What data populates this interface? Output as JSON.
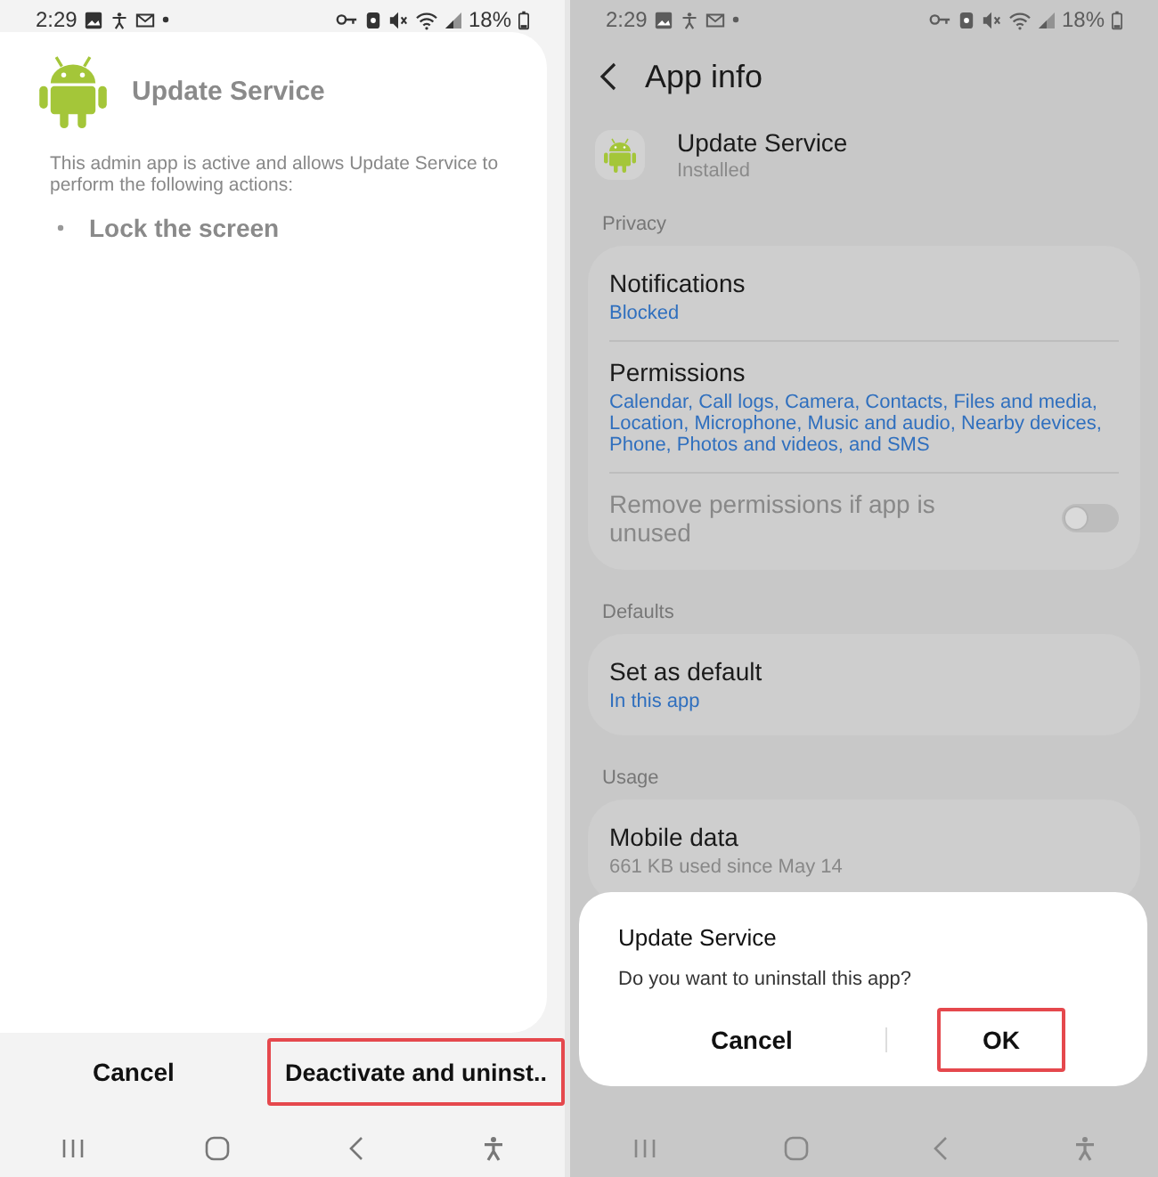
{
  "left_screen": {
    "status_bar": {
      "time": "2:29",
      "battery": "18%"
    },
    "app_name": "Update Service",
    "description": "This admin app is active and allows Update Service to perform the following actions:",
    "actions": [
      "Lock the screen"
    ],
    "buttons": [
      {
        "label": "Cancel",
        "highlighted": false
      },
      {
        "label": "Deactivate and uninst..",
        "highlighted": true
      }
    ]
  },
  "right_screen": {
    "status_bar": {
      "time": "2:29",
      "battery": "18%"
    },
    "title": "App info",
    "app": {
      "name": "Update Service",
      "status": "Installed"
    },
    "sections": [
      {
        "header": "Privacy",
        "items": [
          {
            "kind": "link",
            "title": "Notifications",
            "subtitle": "Blocked"
          },
          {
            "kind": "link",
            "title": "Permissions",
            "subtitle": "Calendar, Call logs, Camera, Contacts, Files and media, Location, Microphone, Music and audio, Nearby devices, Phone, Photos and videos, and SMS"
          },
          {
            "kind": "toggle",
            "title": "Remove permissions if app is unused",
            "on": false,
            "disabled": true
          }
        ]
      },
      {
        "header": "Defaults",
        "items": [
          {
            "kind": "link",
            "title": "Set as default",
            "subtitle": "In this app"
          }
        ]
      },
      {
        "header": "Usage",
        "items": [
          {
            "kind": "info",
            "title": "Mobile data",
            "subtitle": "661 KB used since May 14"
          }
        ]
      }
    ],
    "dialog": {
      "title": "Update Service",
      "message": "Do you want to uninstall this app?",
      "buttons": [
        {
          "label": "Cancel",
          "highlighted": false
        },
        {
          "label": "OK",
          "highlighted": true
        }
      ]
    }
  }
}
